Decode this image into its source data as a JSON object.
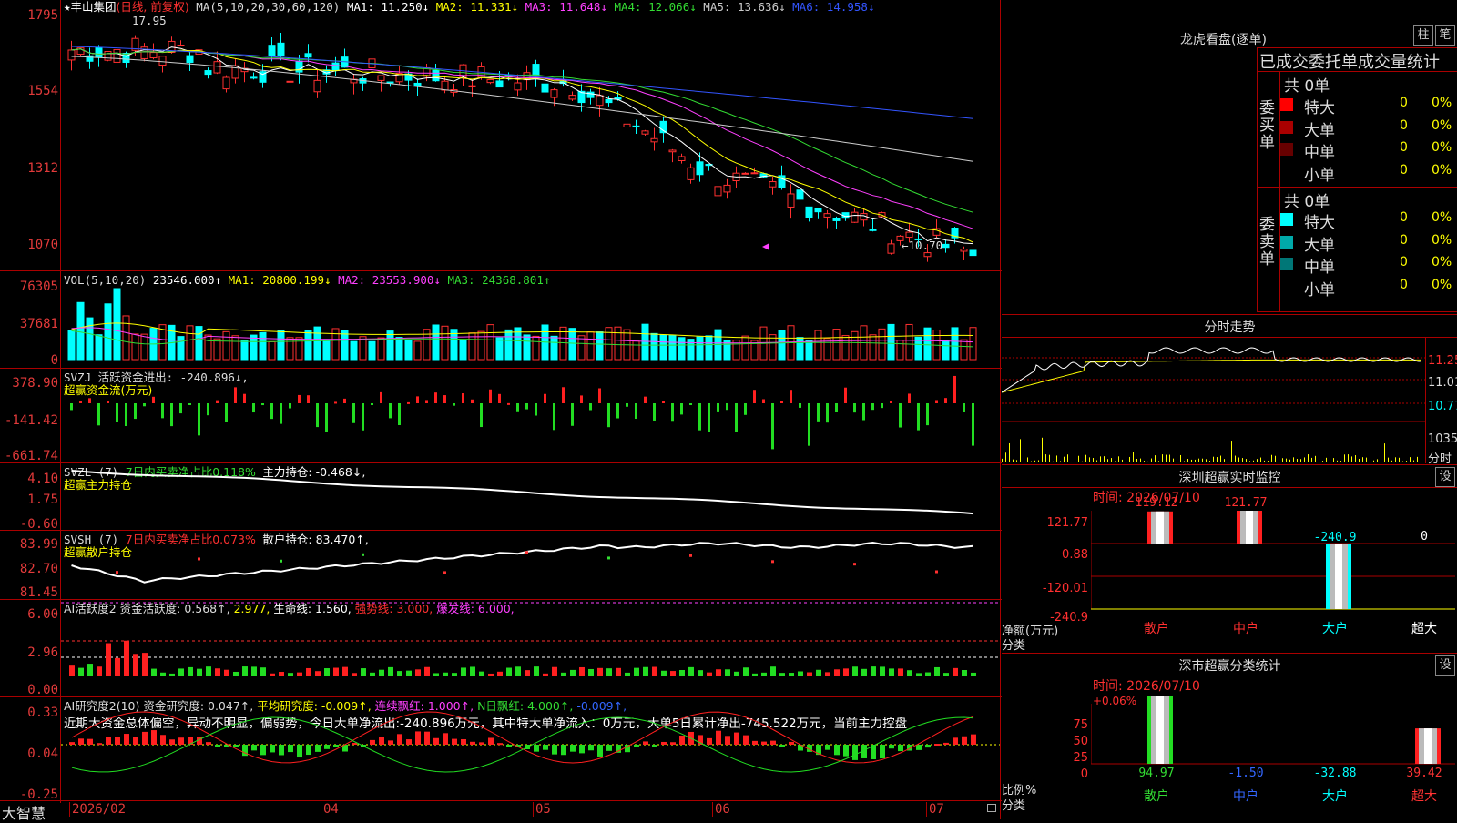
{
  "kline": {
    "title_star": "★",
    "stock_name": "丰山集团",
    "period": "(日线, 前复权)",
    "ma_label": "MA(5,10,20,30,60,120)",
    "ma": [
      {
        "name": "MA1:",
        "value": "11.250↓",
        "color": "#ffffff"
      },
      {
        "name": "MA2:",
        "value": "11.331↓",
        "color": "#ffff00"
      },
      {
        "name": "MA3:",
        "value": "11.648↓",
        "color": "#ff40ff"
      },
      {
        "name": "MA4:",
        "value": "12.066↓",
        "color": "#33dd33"
      },
      {
        "name": "MA5:",
        "value": "13.636↓",
        "color": "#cccccc"
      },
      {
        "name": "MA6:",
        "value": "14.958↓",
        "color": "#3355ff"
      }
    ],
    "price_axis": [
      "1795",
      "1554",
      "1312",
      "1070"
    ],
    "high_label": "17.95",
    "low_label": "←10.70"
  },
  "vol": {
    "label": "VOL(5,10,20)",
    "value": "23546.000↑",
    "ma": [
      {
        "text": "MA1: 20800.199↓",
        "color": "#ffff00"
      },
      {
        "text": "MA2: 23553.900↓",
        "color": "#ff40ff"
      },
      {
        "text": "MA3: 24368.801↑",
        "color": "#33dd33"
      }
    ],
    "axis": [
      "76305",
      "37681",
      "0"
    ]
  },
  "svzj": {
    "label": "SVZJ  活跃资金进出: -240.896↓,",
    "sub": "超赢资金流(万元)",
    "axis": [
      "378.90",
      "-141.42",
      "-661.74"
    ]
  },
  "svzl": {
    "label": "SVZL (7)",
    "desc": "7日内买卖净占比0.118%",
    "hold": "主力持仓: -0.468↓,",
    "sub": "超赢主力持仓",
    "axis": [
      "4.10",
      "1.75",
      "-0.60"
    ]
  },
  "svsh": {
    "label": "SVSH (7)",
    "desc": "7日内买卖净占比0.073%",
    "hold": "散户持仓: 83.470↑,",
    "sub": "超赢散户持仓",
    "axis": [
      "83.99",
      "82.70",
      "81.45"
    ]
  },
  "ai1": {
    "label": "AI活跃度2 资金活跃度: 0.568↑,",
    "v2": "2.977,",
    "v3": "生命线: 1.560,",
    "v4": "强势线: 3.000,",
    "v5": "爆发线: 6.000,",
    "axis": [
      "6.00",
      "2.96",
      "0.00"
    ]
  },
  "ai2": {
    "label": "AI研究度2(10) 资金研究度: 0.047↑,",
    "v2": "平均研究度: -0.009↑,",
    "v3": "连续飘红: 1.000↑,",
    "v4": "N日飘红: 4.000↑,",
    "v5": "-0.009↑,",
    "comment": "近期大资金总体偏空，异动不明显，偏弱势，今日大单净流出:-240.896万元，其中特大单净流入：0万元，大单5日累计净出-745.522万元，当前主力控盘",
    "axis": [
      "0.33",
      "0.04",
      "-0.25"
    ]
  },
  "date_axis": [
    "2026/02",
    "04",
    "05",
    "06",
    "07"
  ],
  "brand": "大智慧",
  "longhu": {
    "title": "龙虎看盘(逐单)",
    "btn1": "柱",
    "btn2": "笔",
    "header": "已成交委托单成交量统计",
    "buy_label": "委买单",
    "sell_label": "委卖单",
    "buy_total": "共 0单",
    "sell_total": "共 0单",
    "buy_rows": [
      {
        "name": "特大",
        "n": "0",
        "pct": "0%",
        "color": "#ff0000"
      },
      {
        "name": "大单",
        "n": "0",
        "pct": "0%",
        "color": "#aa0000"
      },
      {
        "name": "中单",
        "n": "0",
        "pct": "0%",
        "color": "#660000"
      },
      {
        "name": "小单",
        "n": "0",
        "pct": "0%",
        "color": ""
      }
    ],
    "sell_rows": [
      {
        "name": "特大",
        "n": "0",
        "pct": "0%",
        "color": "#00ffff"
      },
      {
        "name": "大单",
        "n": "0",
        "pct": "0%",
        "color": "#00aaaa"
      },
      {
        "name": "中单",
        "n": "0",
        "pct": "0%",
        "color": "#007777"
      },
      {
        "name": "小单",
        "n": "0",
        "pct": "0%",
        "color": ""
      }
    ]
  },
  "fenshi": {
    "title": "分时走势",
    "axis": [
      "11.25",
      "11.01",
      "10.77",
      "1035",
      "分时"
    ]
  },
  "sz_monitor": {
    "title": "深圳超赢实时监控",
    "btn": "设",
    "time": "时间: 2026/07/10",
    "axis": [
      "121.77",
      "0.88",
      "-120.01",
      "-240.9"
    ],
    "ylabel": "净额(万元)",
    "xlabel": "分类",
    "values": [
      "119.12",
      "121.77",
      "-240.9",
      "0"
    ],
    "categories": [
      "散户",
      "中户",
      "大户",
      "超大"
    ]
  },
  "sz_class": {
    "title": "深市超赢分类统计",
    "btn": "设",
    "time": "时间: 2026/07/10",
    "top_label": "+0.06%",
    "axis": [
      "75",
      "50",
      "25",
      "0"
    ],
    "ylabel": "比例%",
    "xlabel": "分类",
    "values": [
      "94.97",
      "-1.50",
      "-32.88",
      "39.42"
    ],
    "value_colors": [
      "#33dd33",
      "#3366ff",
      "#00ffff",
      "#ff3333"
    ],
    "categories": [
      "散户",
      "中户",
      "大户",
      "超大"
    ]
  }
}
